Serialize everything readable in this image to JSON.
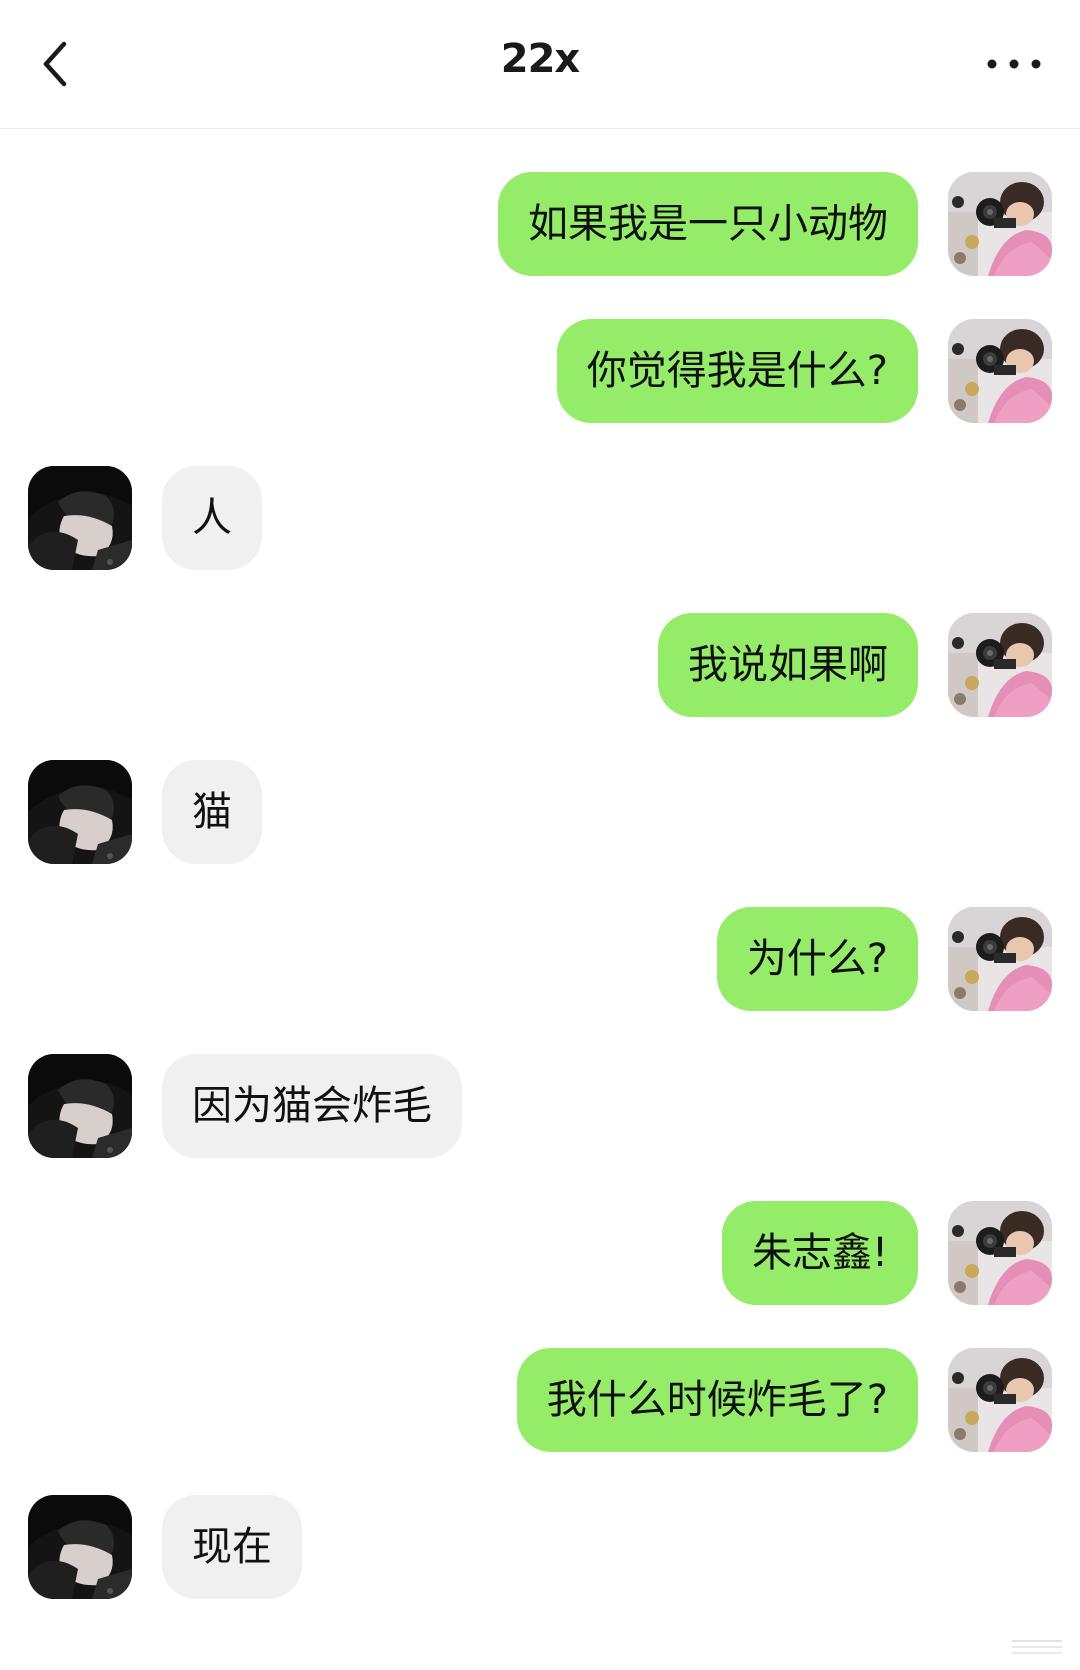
{
  "header": {
    "title": "22x",
    "back_icon": "chevron-left-icon",
    "more_icon": "more-dots-icon"
  },
  "colors": {
    "sent_bubble": "#95ec69",
    "received_bubble": "#f0f0f0",
    "background": "#ffffff"
  },
  "messages": [
    {
      "side": "sent",
      "text": "如果我是一只小动物"
    },
    {
      "side": "sent",
      "text": "你觉得我是什么?"
    },
    {
      "side": "received",
      "text": "人"
    },
    {
      "side": "sent",
      "text": "我说如果啊"
    },
    {
      "side": "received",
      "text": "猫"
    },
    {
      "side": "sent",
      "text": "为什么?"
    },
    {
      "side": "received",
      "text": "因为猫会炸毛"
    },
    {
      "side": "sent",
      "text": "朱志鑫!"
    },
    {
      "side": "sent",
      "text": "我什么时候炸毛了?"
    },
    {
      "side": "received",
      "text": "现在"
    }
  ]
}
